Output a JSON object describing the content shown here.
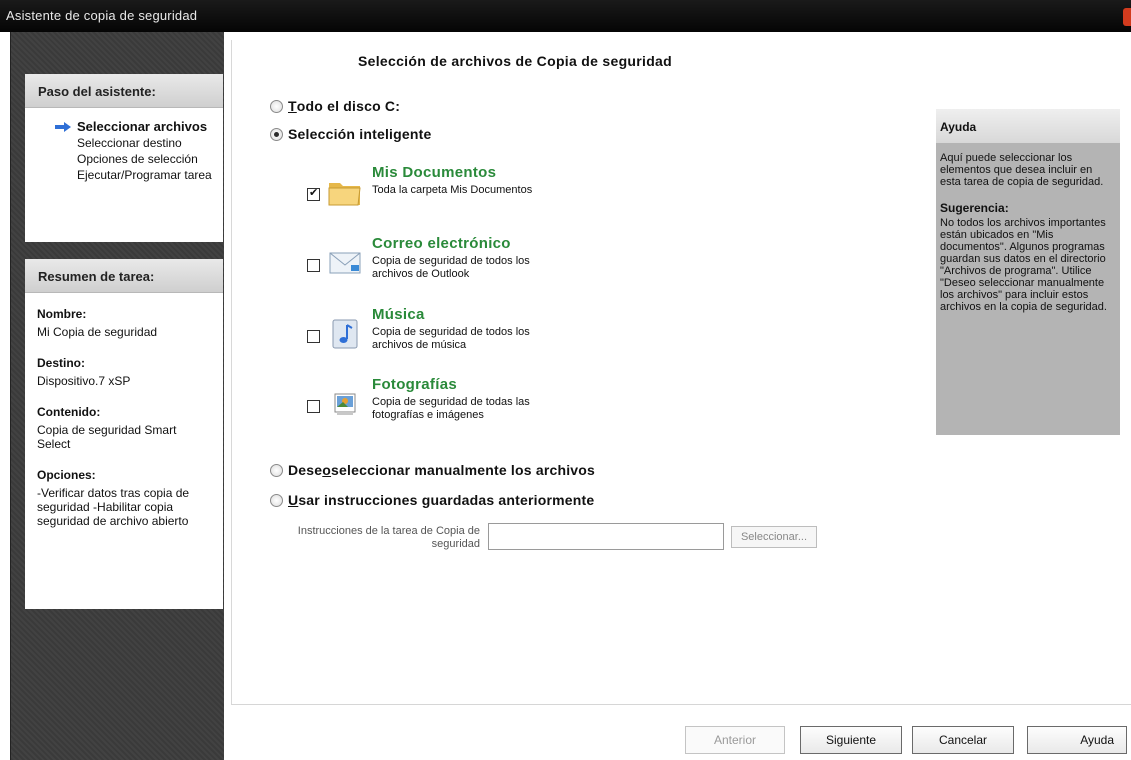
{
  "window": {
    "title": "Asistente de copia de seguridad"
  },
  "wizard_steps": {
    "header": "Paso del asistente:",
    "items": [
      {
        "label": "Seleccionar archivos",
        "active": true
      },
      {
        "label": "Seleccionar destino",
        "active": false
      },
      {
        "label": "Opciones de selección",
        "active": false
      },
      {
        "label": "Ejecutar/Programar tarea",
        "active": false
      }
    ]
  },
  "summary": {
    "header": "Resumen de tarea:",
    "name_label": "Nombre:",
    "name_value": "Mi Copia de seguridad",
    "dest_label": "Destino:",
    "dest_value": "Dispositivo.7 xSP",
    "content_label": "Contenido:",
    "content_value": "Copia de seguridad Smart Select",
    "options_label": "Opciones:",
    "options_value": "-Verificar datos tras copia de seguridad -Habilitar copia seguridad de archivo abierto"
  },
  "main": {
    "title": "Selección de archivos de Copia de seguridad",
    "radio_full_disk": {
      "accel": "T",
      "rest": "odo el disco C:",
      "selected": false
    },
    "radio_smart": {
      "label": "Selección inteligente",
      "selected": true
    },
    "items": [
      {
        "title": "Mis Documentos",
        "desc": "Toda la carpeta Mis Documentos",
        "checked": true,
        "icon": "folder-icon"
      },
      {
        "title": "Correo electrónico",
        "desc": "Copia de seguridad de todos los archivos de Outlook",
        "checked": false,
        "icon": "mail-icon"
      },
      {
        "title": "Música",
        "desc": "Copia de seguridad de todos los archivos de música",
        "checked": false,
        "icon": "music-icon"
      },
      {
        "title": "Fotografías",
        "desc": "Copia de seguridad de todas las fotografías e imágenes",
        "checked": false,
        "icon": "photo-icon"
      }
    ],
    "radio_manual": {
      "pre": "Dese",
      "accel": "o",
      "rest": " seleccionar manualmente los archivos",
      "selected": false
    },
    "radio_saved": {
      "accel": "U",
      "rest": "sar instrucciones guardadas anteriormente",
      "selected": false
    },
    "instructions_label": "Instrucciones de la tarea de Copia de seguridad",
    "instructions_value": "",
    "select_button": "Seleccionar..."
  },
  "help": {
    "header": "Ayuda",
    "body": "Aquí puede seleccionar los elementos que desea incluir en esta tarea de copia de seguridad.",
    "tip_header": "Sugerencia:",
    "tip_body": "No todos los archivos importantes están ubicados en \"Mis documentos\". Algunos programas guardan sus datos en el directorio \"Archivos de programa\". Utilice \"Deseo seleccionar manualmente los archivos\" para incluir estos archivos en la copia de seguridad."
  },
  "footer": {
    "back": "Anterior",
    "next": "Siguiente",
    "cancel": "Cancelar",
    "help": "Ayuda"
  },
  "colors": {
    "item_title": "#2a8a3a",
    "sidebar_bg": "#3e3e3e",
    "help_bg": "#b4b4b4",
    "arrow": "#2f6fd6"
  }
}
